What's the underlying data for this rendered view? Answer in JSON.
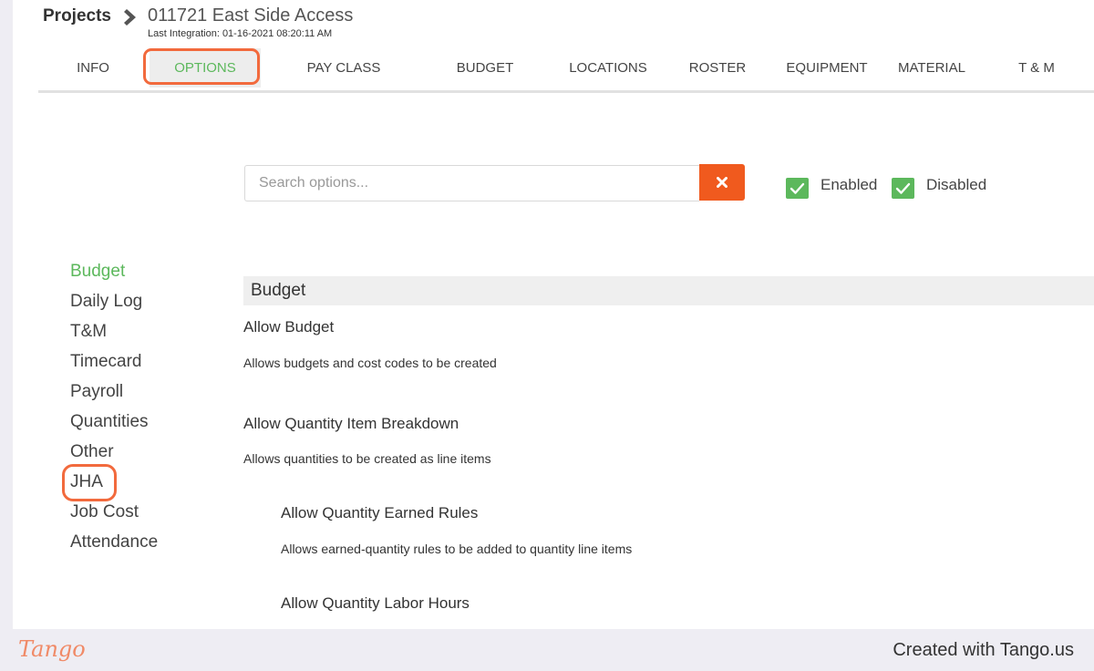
{
  "header": {
    "breadcrumb_root": "Projects",
    "project_name": "011721 East Side Access",
    "last_integration": "Last Integration: 01-16-2021 08:20:11 AM"
  },
  "tabs": [
    {
      "label": "INFO"
    },
    {
      "label": "OPTIONS",
      "active": true
    },
    {
      "label": "PAY CLASS"
    },
    {
      "label": "BUDGET"
    },
    {
      "label": "LOCATIONS"
    },
    {
      "label": "ROSTER"
    },
    {
      "label": "EQUIPMENT"
    },
    {
      "label": "MATERIAL"
    },
    {
      "label": "T & M"
    }
  ],
  "search": {
    "placeholder": "Search options...",
    "value": "",
    "clear_icon": "x-icon"
  },
  "filters": {
    "enabled_label": "Enabled",
    "enabled_checked": true,
    "disabled_label": "Disabled",
    "disabled_checked": true
  },
  "sidebar": {
    "items": [
      {
        "label": "Budget",
        "active": true
      },
      {
        "label": "Daily Log"
      },
      {
        "label": "T&M"
      },
      {
        "label": "Timecard"
      },
      {
        "label": "Payroll"
      },
      {
        "label": "Quantities"
      },
      {
        "label": "Other"
      },
      {
        "label": "JHA"
      },
      {
        "label": "Job Cost"
      },
      {
        "label": "Attendance"
      }
    ]
  },
  "section": {
    "title": "Budget",
    "options": [
      {
        "title": "Allow Budget",
        "description": "Allows budgets and cost codes to be created"
      },
      {
        "title": "Allow Quantity Item Breakdown",
        "description": "Allows quantities to be created as line items"
      },
      {
        "title": "Allow Quantity Earned Rules",
        "description": "Allows earned-quantity rules to be added to quantity line items"
      },
      {
        "title": "Allow Quantity Labor Hours"
      }
    ]
  },
  "footer": {
    "logo_text": "Tango",
    "created_with": "Created with Tango.us"
  },
  "colors": {
    "accent_green": "#5cb85c",
    "clear_button": "#f05a1e",
    "highlight_outline": "#f26a3d"
  }
}
